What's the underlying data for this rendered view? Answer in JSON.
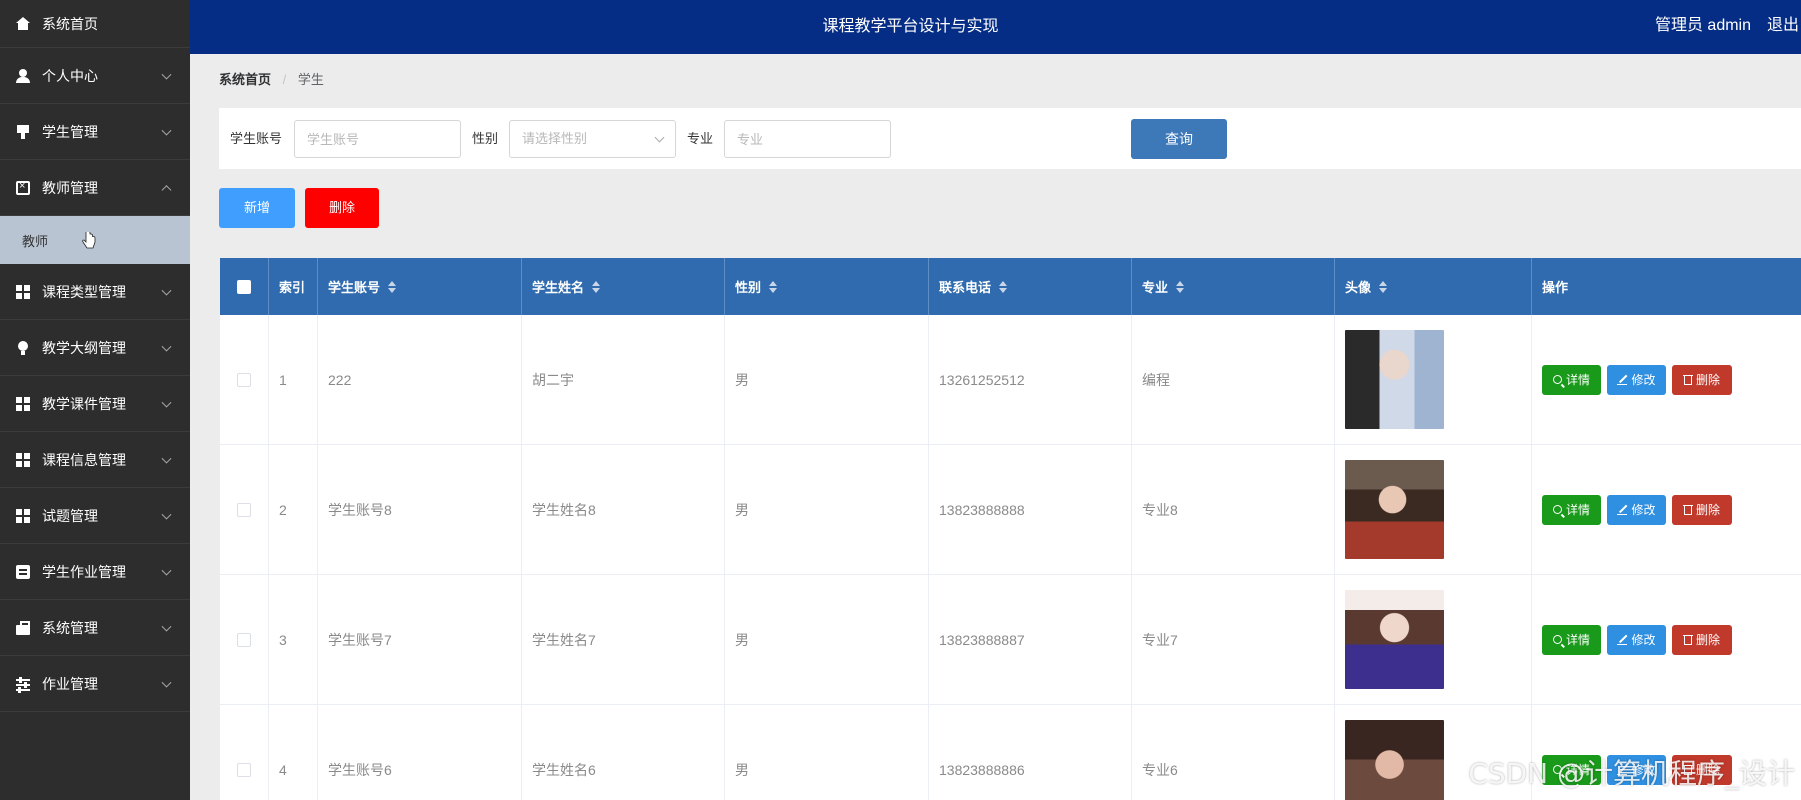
{
  "app": {
    "title": "课程教学平台设计与实现",
    "user": "管理员 admin",
    "logout": "退出"
  },
  "sidebar": {
    "items": [
      {
        "label": "系统首页",
        "icon": "home-icon"
      },
      {
        "label": "个人中心",
        "icon": "user-icon"
      },
      {
        "label": "学生管理",
        "icon": "flag-icon"
      },
      {
        "label": "教师管理",
        "icon": "clipboard-icon",
        "expanded": true
      },
      {
        "label": "课程类型管理",
        "icon": "grid-icon"
      },
      {
        "label": "教学大纲管理",
        "icon": "bulb-icon"
      },
      {
        "label": "教学课件管理",
        "icon": "grid-icon"
      },
      {
        "label": "课程信息管理",
        "icon": "grid-icon"
      },
      {
        "label": "试题管理",
        "icon": "grid-icon"
      },
      {
        "label": "学生作业管理",
        "icon": "note-icon"
      },
      {
        "label": "系统管理",
        "icon": "briefcase-icon"
      },
      {
        "label": "作业管理",
        "icon": "sliders-icon"
      }
    ],
    "submenu": {
      "label": "教师"
    }
  },
  "breadcrumb": {
    "home": "系统首页",
    "separator": "/",
    "current": "学生"
  },
  "search": {
    "account_label": "学生账号",
    "account_placeholder": "学生账号",
    "gender_label": "性别",
    "gender_placeholder": "请选择性别",
    "major_label": "专业",
    "major_placeholder": "专业",
    "query_button": "查询"
  },
  "actions": {
    "add": "新增",
    "delete": "删除"
  },
  "table": {
    "headers": {
      "index": "索引",
      "account": "学生账号",
      "name": "学生姓名",
      "gender": "性别",
      "phone": "联系电话",
      "major": "专业",
      "avatar": "头像",
      "ops": "操作"
    },
    "rows": [
      {
        "index": "1",
        "account": "222",
        "name": "胡二宇",
        "gender": "男",
        "phone": "13261252512",
        "major": "编程"
      },
      {
        "index": "2",
        "account": "学生账号8",
        "name": "学生姓名8",
        "gender": "男",
        "phone": "13823888888",
        "major": "专业8"
      },
      {
        "index": "3",
        "account": "学生账号7",
        "name": "学生姓名7",
        "gender": "男",
        "phone": "13823888887",
        "major": "专业7"
      },
      {
        "index": "4",
        "account": "学生账号6",
        "name": "学生姓名6",
        "gender": "男",
        "phone": "13823888886",
        "major": "专业6"
      }
    ],
    "op_labels": {
      "detail": "详情",
      "edit": "修改",
      "remove": "删除"
    }
  },
  "watermark": "CSDN @计算机程序_设计",
  "colors": {
    "sidebar": "#2d2d2d",
    "topbar": "#062d85",
    "table_header": "#2f6bae",
    "query": "#3d78b8",
    "add": "#409eff",
    "delete": "#ff0000",
    "detail": "#1a9a1a",
    "edit": "#2f8fe0",
    "remove": "#c0392b"
  }
}
